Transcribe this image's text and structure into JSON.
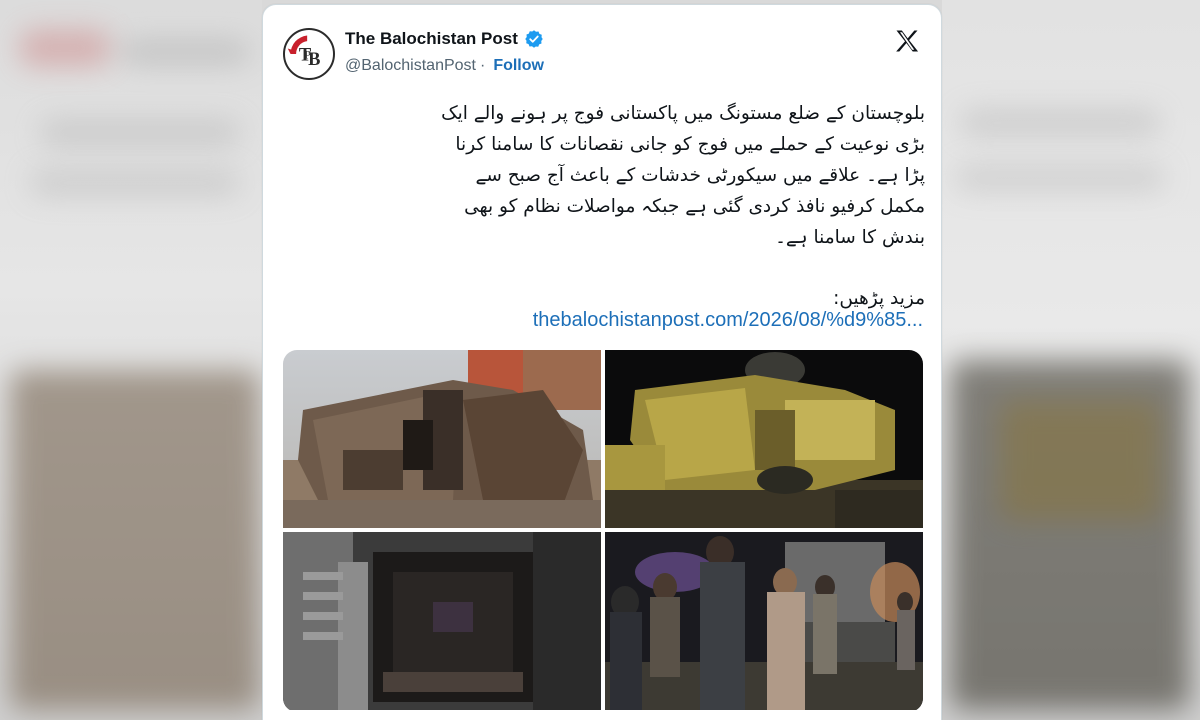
{
  "account": {
    "display_name": "The Balochistan Post",
    "handle": "@BalochistanPost",
    "separator": "·",
    "follow_label": "Follow",
    "avatar_initials": "TBP",
    "verified": true
  },
  "tweet": {
    "text": "بلوچستان کے ضلع مستونگ میں پاکستانی فوج پر ہونے والے ایک بڑی نوعیت کے حملے میں فوج کو جانی نقصانات کا سامنا کرنا پڑا ہے۔ علاقے میں سیکورٹی خدشات کے باعث آج صبح سے مکمل کرفیو نافذ کردی گئی ہے جبکہ مواصلات نظام کو بھی بندش کا سامنا ہے۔",
    "read_more": "مزید پڑھیں:",
    "link": "thebalochistanpost.com/2026/08/%d9%85..."
  },
  "media": [
    {
      "name": "photo-wrecked-truck"
    },
    {
      "name": "photo-overturned-vehicle-night"
    },
    {
      "name": "photo-burnt-interior"
    },
    {
      "name": "photo-people-at-night"
    }
  ],
  "colors": {
    "link": "#1d6fb8",
    "verified": "#1d9bf0",
    "text": "#0f1419",
    "muted": "#536471",
    "brand_red": "#c8202c"
  },
  "icons": {
    "platform": "x-logo-icon",
    "verified": "verified-badge-icon"
  }
}
